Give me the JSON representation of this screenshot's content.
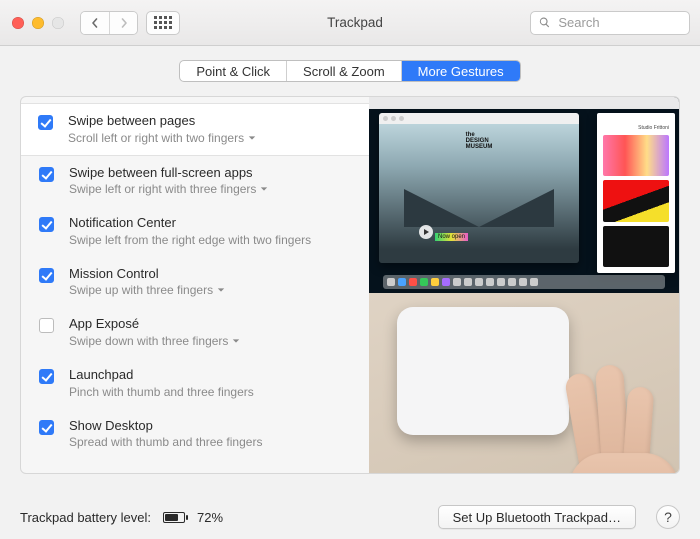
{
  "window": {
    "title": "Trackpad"
  },
  "search": {
    "placeholder": "Search",
    "value": ""
  },
  "tabs": [
    {
      "label": "Point & Click",
      "active": false
    },
    {
      "label": "Scroll & Zoom",
      "active": false
    },
    {
      "label": "More Gestures",
      "active": true
    }
  ],
  "options": [
    {
      "title": "Swipe between pages",
      "sub": "Scroll left or right with two fingers",
      "checked": true,
      "dropdown": true,
      "selected": true
    },
    {
      "title": "Swipe between full-screen apps",
      "sub": "Swipe left or right with three fingers",
      "checked": true,
      "dropdown": true,
      "selected": false
    },
    {
      "title": "Notification Center",
      "sub": "Swipe left from the right edge with two fingers",
      "checked": true,
      "dropdown": false,
      "selected": false
    },
    {
      "title": "Mission Control",
      "sub": "Swipe up with three fingers",
      "checked": true,
      "dropdown": true,
      "selected": false
    },
    {
      "title": "App Exposé",
      "sub": "Swipe down with three fingers",
      "checked": false,
      "dropdown": true,
      "selected": false
    },
    {
      "title": "Launchpad",
      "sub": "Pinch with thumb and three fingers",
      "checked": true,
      "dropdown": false,
      "selected": false
    },
    {
      "title": "Show Desktop",
      "sub": "Spread with thumb and three fingers",
      "checked": true,
      "dropdown": false,
      "selected": false
    }
  ],
  "demo": {
    "site_logo_line1": "the",
    "site_logo_line2": "DESIGN",
    "site_logo_line3": "MUSEUM",
    "tagline": "Now open",
    "sidebar_label": "Studio Frittoni"
  },
  "footer": {
    "battery_label": "Trackpad battery level:",
    "battery_pct_text": "72%",
    "battery_fill_pct": 72,
    "setup_button": "Set Up Bluetooth Trackpad…",
    "help": "?"
  }
}
